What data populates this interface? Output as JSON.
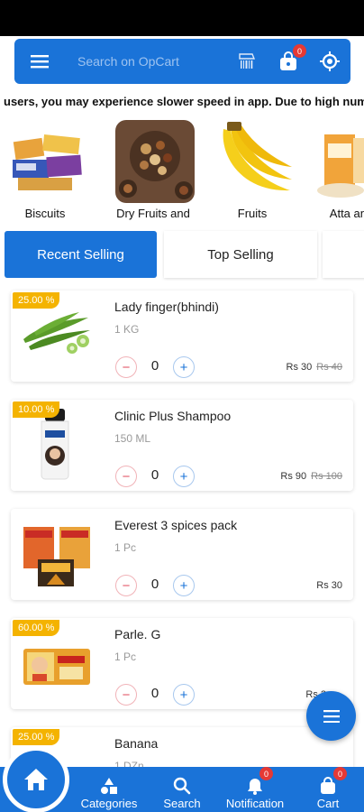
{
  "header": {
    "search_placeholder": "Search on OpCart",
    "cart_badge": "0"
  },
  "marquee_text": "users, you may experience slower speed in app.  Due to  high num",
  "categories": [
    {
      "label": "Biscuits"
    },
    {
      "label": "Dry Fruits and"
    },
    {
      "label": "Fruits"
    },
    {
      "label": "Atta and"
    }
  ],
  "tabs": {
    "recent": "Recent Selling",
    "top": "Top Selling"
  },
  "products": [
    {
      "name": "Lady finger(bhindi)",
      "unit": "1 KG",
      "discount": "25.00 %",
      "qty": "0",
      "price": "Rs 30",
      "mrp": "Rs 40"
    },
    {
      "name": "Clinic Plus Shampoo",
      "unit": "150 ML",
      "discount": "10.00 %",
      "qty": "0",
      "price": "Rs 90",
      "mrp": "Rs 100"
    },
    {
      "name": "Everest 3 spices pack",
      "unit": "1 Pc",
      "discount": "",
      "qty": "0",
      "price": "Rs 30",
      "mrp": ""
    },
    {
      "name": "Parle. G",
      "unit": "1 Pc",
      "discount": "60.00 %",
      "qty": "0",
      "price": "Rs 2",
      "mrp": ""
    },
    {
      "name": "Banana",
      "unit": "1 DZn",
      "discount": "25.00 %",
      "qty": "",
      "price": "",
      "mrp": ""
    }
  ],
  "bottom_nav": {
    "categories": "Categories",
    "search": "Search",
    "notification": "Notification",
    "notification_badge": "0",
    "cart": "Cart",
    "cart_badge": "0"
  },
  "colors": {
    "primary": "#1a73d8",
    "discount": "#f4b300",
    "badge": "#e53935"
  }
}
